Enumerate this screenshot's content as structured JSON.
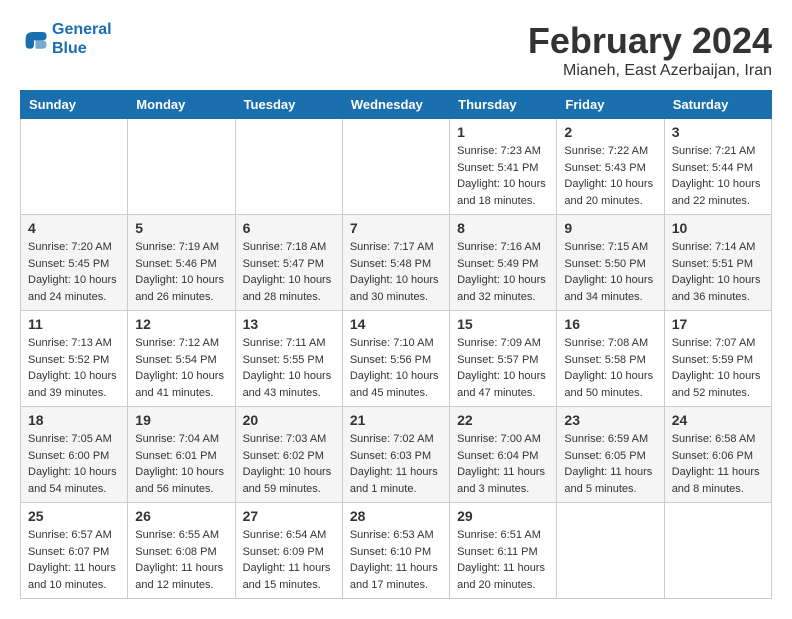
{
  "logo": {
    "line1": "General",
    "line2": "Blue"
  },
  "title": "February 2024",
  "subtitle": "Mianeh, East Azerbaijan, Iran",
  "days_header": [
    "Sunday",
    "Monday",
    "Tuesday",
    "Wednesday",
    "Thursday",
    "Friday",
    "Saturday"
  ],
  "weeks": [
    [
      {
        "num": "",
        "info": ""
      },
      {
        "num": "",
        "info": ""
      },
      {
        "num": "",
        "info": ""
      },
      {
        "num": "",
        "info": ""
      },
      {
        "num": "1",
        "sunrise": "7:23 AM",
        "sunset": "5:41 PM",
        "daylight": "10 hours and 18 minutes."
      },
      {
        "num": "2",
        "sunrise": "7:22 AM",
        "sunset": "5:43 PM",
        "daylight": "10 hours and 20 minutes."
      },
      {
        "num": "3",
        "sunrise": "7:21 AM",
        "sunset": "5:44 PM",
        "daylight": "10 hours and 22 minutes."
      }
    ],
    [
      {
        "num": "4",
        "sunrise": "7:20 AM",
        "sunset": "5:45 PM",
        "daylight": "10 hours and 24 minutes."
      },
      {
        "num": "5",
        "sunrise": "7:19 AM",
        "sunset": "5:46 PM",
        "daylight": "10 hours and 26 minutes."
      },
      {
        "num": "6",
        "sunrise": "7:18 AM",
        "sunset": "5:47 PM",
        "daylight": "10 hours and 28 minutes."
      },
      {
        "num": "7",
        "sunrise": "7:17 AM",
        "sunset": "5:48 PM",
        "daylight": "10 hours and 30 minutes."
      },
      {
        "num": "8",
        "sunrise": "7:16 AM",
        "sunset": "5:49 PM",
        "daylight": "10 hours and 32 minutes."
      },
      {
        "num": "9",
        "sunrise": "7:15 AM",
        "sunset": "5:50 PM",
        "daylight": "10 hours and 34 minutes."
      },
      {
        "num": "10",
        "sunrise": "7:14 AM",
        "sunset": "5:51 PM",
        "daylight": "10 hours and 36 minutes."
      }
    ],
    [
      {
        "num": "11",
        "sunrise": "7:13 AM",
        "sunset": "5:52 PM",
        "daylight": "10 hours and 39 minutes."
      },
      {
        "num": "12",
        "sunrise": "7:12 AM",
        "sunset": "5:54 PM",
        "daylight": "10 hours and 41 minutes."
      },
      {
        "num": "13",
        "sunrise": "7:11 AM",
        "sunset": "5:55 PM",
        "daylight": "10 hours and 43 minutes."
      },
      {
        "num": "14",
        "sunrise": "7:10 AM",
        "sunset": "5:56 PM",
        "daylight": "10 hours and 45 minutes."
      },
      {
        "num": "15",
        "sunrise": "7:09 AM",
        "sunset": "5:57 PM",
        "daylight": "10 hours and 47 minutes."
      },
      {
        "num": "16",
        "sunrise": "7:08 AM",
        "sunset": "5:58 PM",
        "daylight": "10 hours and 50 minutes."
      },
      {
        "num": "17",
        "sunrise": "7:07 AM",
        "sunset": "5:59 PM",
        "daylight": "10 hours and 52 minutes."
      }
    ],
    [
      {
        "num": "18",
        "sunrise": "7:05 AM",
        "sunset": "6:00 PM",
        "daylight": "10 hours and 54 minutes."
      },
      {
        "num": "19",
        "sunrise": "7:04 AM",
        "sunset": "6:01 PM",
        "daylight": "10 hours and 56 minutes."
      },
      {
        "num": "20",
        "sunrise": "7:03 AM",
        "sunset": "6:02 PM",
        "daylight": "10 hours and 59 minutes."
      },
      {
        "num": "21",
        "sunrise": "7:02 AM",
        "sunset": "6:03 PM",
        "daylight": "11 hours and 1 minute."
      },
      {
        "num": "22",
        "sunrise": "7:00 AM",
        "sunset": "6:04 PM",
        "daylight": "11 hours and 3 minutes."
      },
      {
        "num": "23",
        "sunrise": "6:59 AM",
        "sunset": "6:05 PM",
        "daylight": "11 hours and 5 minutes."
      },
      {
        "num": "24",
        "sunrise": "6:58 AM",
        "sunset": "6:06 PM",
        "daylight": "11 hours and 8 minutes."
      }
    ],
    [
      {
        "num": "25",
        "sunrise": "6:57 AM",
        "sunset": "6:07 PM",
        "daylight": "11 hours and 10 minutes."
      },
      {
        "num": "26",
        "sunrise": "6:55 AM",
        "sunset": "6:08 PM",
        "daylight": "11 hours and 12 minutes."
      },
      {
        "num": "27",
        "sunrise": "6:54 AM",
        "sunset": "6:09 PM",
        "daylight": "11 hours and 15 minutes."
      },
      {
        "num": "28",
        "sunrise": "6:53 AM",
        "sunset": "6:10 PM",
        "daylight": "11 hours and 17 minutes."
      },
      {
        "num": "29",
        "sunrise": "6:51 AM",
        "sunset": "6:11 PM",
        "daylight": "11 hours and 20 minutes."
      },
      {
        "num": "",
        "info": ""
      },
      {
        "num": "",
        "info": ""
      }
    ]
  ]
}
